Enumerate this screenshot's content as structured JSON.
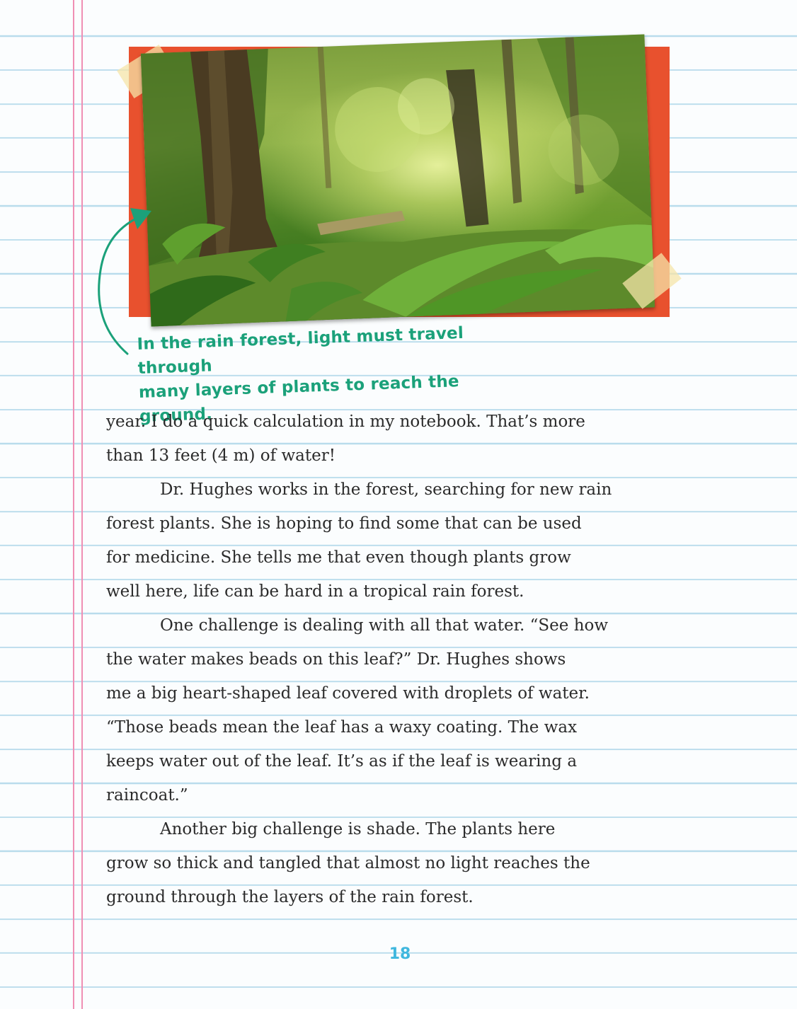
{
  "photo": {
    "subject": "rain forest interior",
    "frame_color": "#e8512e"
  },
  "caption": {
    "line1": "In the rain forest, light must travel through",
    "line2": "many layers of plants to reach the ground.",
    "color": "#1ba17a"
  },
  "body": {
    "p1_line1": "year. I do a quick calculation in my notebook. That’s more",
    "p1_line2": "than 13 feet (4 m) of water!",
    "p2_line1": "Dr. Hughes works in the forest, searching for new rain",
    "p2_line2": "forest plants. She is hoping to find some that can be used",
    "p2_line3": "for medicine. She tells me that even though plants grow",
    "p2_line4": "well here, life can be hard in a tropical rain forest.",
    "p3_line1": "One challenge is dealing with all that water. “See how",
    "p3_line2": "the water makes beads on this leaf?” Dr. Hughes shows",
    "p3_line3": "me a big heart-shaped leaf covered with droplets of water.",
    "p3_line4": "“Those beads mean the leaf has a waxy coating. The wax",
    "p3_line5": "keeps water out of the leaf. It’s as if the leaf is wearing a",
    "p3_line6": "raincoat.”",
    "p4_line1": "Another big challenge is shade. The plants here",
    "p4_line2": "grow so thick and tangled that almost no light reaches the",
    "p4_line3": "ground through the layers of the rain forest."
  },
  "page_number": "18",
  "colors": {
    "ruled_line": "#b9dcec",
    "margin_line": "#f08fb4",
    "page_number": "#3fb7de"
  }
}
